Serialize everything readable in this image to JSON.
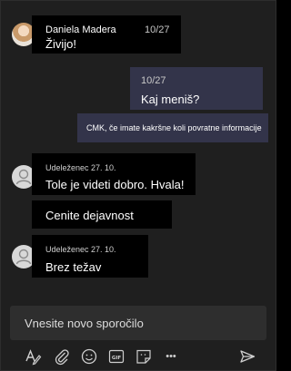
{
  "messages": [
    {
      "sender": "Daniela Madera",
      "time": "10/27",
      "text": "Živijo!"
    },
    {
      "time": "10/27",
      "text": "Kaj meniš?"
    },
    {
      "text": "CMK, če imate kakršne koli povratne informacije"
    },
    {
      "sender": "Udeleženec 27. 10.",
      "text": "Tole je videti dobro. Hvala!"
    },
    {
      "text": "Cenite dejavnost"
    },
    {
      "sender": "Udeleženec 27. 10.",
      "text": "Brez težav"
    }
  ],
  "composer": {
    "placeholder": "Vnesite novo sporočilo"
  },
  "toolbar": {
    "icons": [
      "format-icon",
      "attach-icon",
      "emoji-icon",
      "gif-icon",
      "sticker-icon",
      "more-icon",
      "send-icon"
    ],
    "gif_label": "GIF",
    "more_label": "•••"
  },
  "colors": {
    "background": "#1f1f1f",
    "bubble": "#000000",
    "own_bubble": "#33344a",
    "composer": "#2e2e2e"
  }
}
